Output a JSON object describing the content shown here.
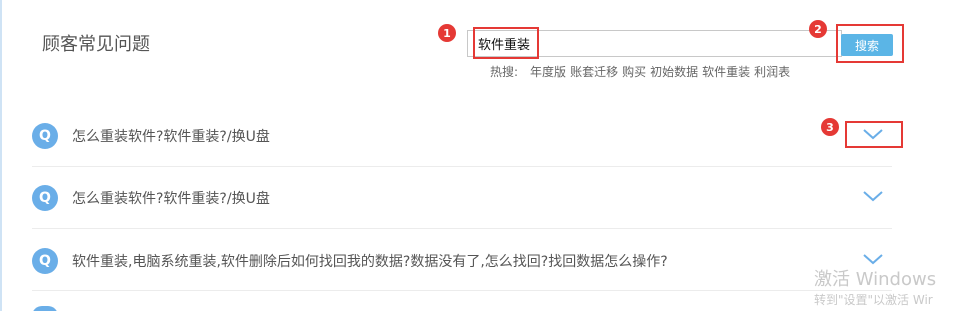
{
  "header": {
    "title": "顾客常见问题"
  },
  "search": {
    "value": "软件重装",
    "button_label": "搜索"
  },
  "hot_searches": {
    "label": "热搜:",
    "items": [
      "年度版",
      "账套迁移",
      "购买",
      "初始数据",
      "软件重装",
      "利润表"
    ]
  },
  "annotations": {
    "badge_1": "1",
    "badge_2": "2",
    "badge_3": "3",
    "color": "#e53935"
  },
  "faq": {
    "items": [
      {
        "icon": "Q",
        "question": "怎么重装软件?软件重装?/换U盘"
      },
      {
        "icon": "Q",
        "question": "怎么重装软件?软件重装?/换U盘"
      },
      {
        "icon": "Q",
        "question": "软件重装,电脑系统重装,软件删除后如何找回我的数据?数据没有了,怎么找回?找回数据怎么操作?"
      }
    ]
  },
  "watermark": {
    "title": "激活 Windows",
    "subtitle": "转到\"设置\"以激活 Wir"
  },
  "colors": {
    "accent": "#5bb5e6",
    "q_icon": "#6aaee8",
    "chevron": "#6aaee8"
  }
}
